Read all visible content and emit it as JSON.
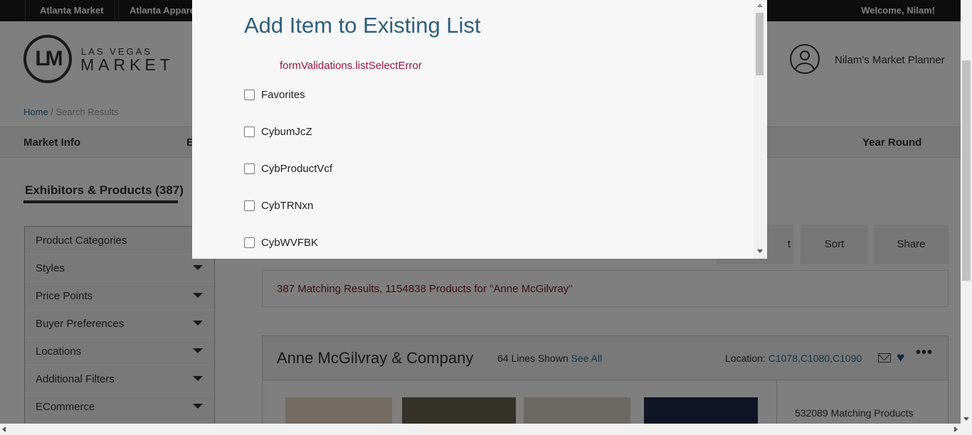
{
  "topbar": {
    "tabs": [
      "Atlanta Market",
      "Atlanta Apparel"
    ],
    "welcome": "Welcome, Nilam!"
  },
  "header": {
    "logo_line1": "LAS VEGAS",
    "logo_line2": "MARKET",
    "logo_mark": "LM",
    "planner_label": "Nilam's Market Planner"
  },
  "breadcrumb": {
    "home": "Home",
    "separator": " / ",
    "current": "Search Results"
  },
  "nav": {
    "items": [
      "Market Info",
      "E",
      "Year Round"
    ]
  },
  "main": {
    "tab_label": "Exhibitors & Products (387)",
    "filters": [
      {
        "label": "Product Categories"
      },
      {
        "label": "Styles"
      },
      {
        "label": "Price Points"
      },
      {
        "label": "Buyer Preferences"
      },
      {
        "label": "Locations"
      },
      {
        "label": "Additional Filters"
      },
      {
        "label": "ECommerce"
      }
    ],
    "buttons": {
      "partial": "t",
      "sort": "Sort",
      "share": "Share"
    },
    "results_summary": "387 Matching Results, 1154838 Products for \"Anne McGilvray\"",
    "exhibitor": {
      "name": "Anne McGilvray & Company",
      "lines_shown": "64 Lines Shown",
      "see_all": "See All",
      "location_label": "Location:",
      "location_codes": "C1078,C1080,C1090",
      "matching_products": "532089 Matching Products"
    }
  },
  "modal": {
    "title": "Add Item to Existing List",
    "error": "formValidations.listSelectError",
    "lists": [
      {
        "name": "Favorites",
        "checked": false
      },
      {
        "name": "CybumJcZ",
        "checked": false
      },
      {
        "name": "CybProductVcf",
        "checked": false
      },
      {
        "name": "CybTRNxn",
        "checked": false
      },
      {
        "name": "CybWVFBK",
        "checked": false
      }
    ]
  },
  "colors": {
    "modal_title": "#2e5f7d",
    "error_text": "#a0173c",
    "link": "#2e6d8e",
    "topbar_bg": "#1b1b1b"
  }
}
